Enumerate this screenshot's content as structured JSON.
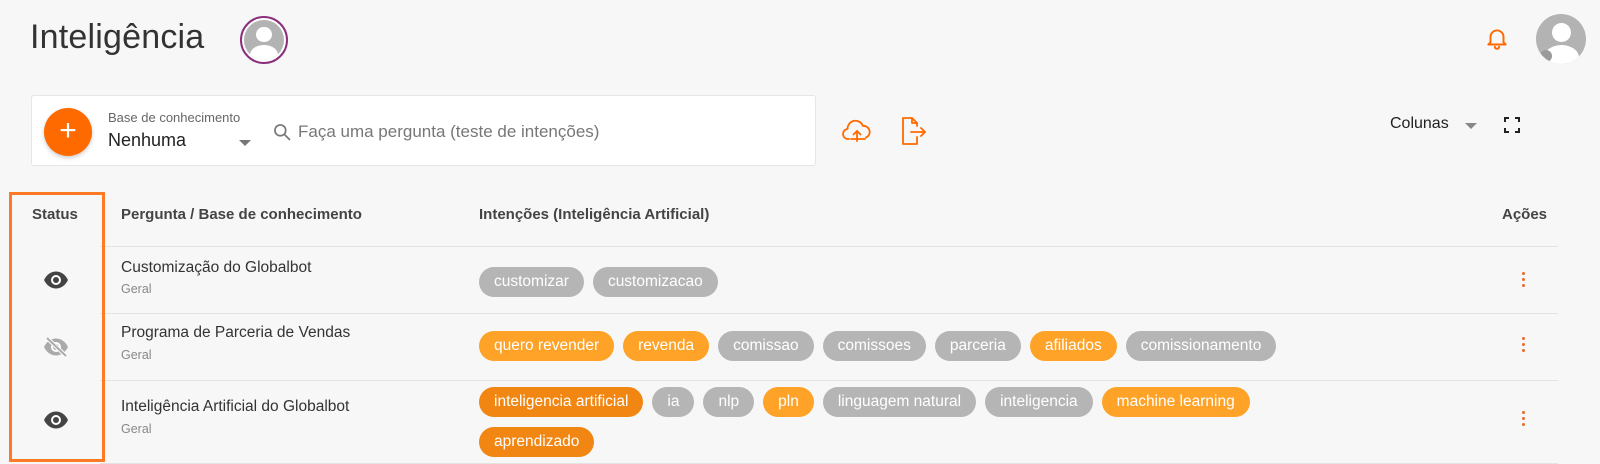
{
  "header": {
    "title": "Inteligência"
  },
  "search": {
    "kb_label": "Base de conhecimento",
    "kb_value": "Nenhuma",
    "placeholder": "Faça uma pergunta (teste de intenções)",
    "add_label": "+"
  },
  "toolbar": {
    "columns_label": "Colunas"
  },
  "table": {
    "headers": {
      "status": "Status",
      "question": "Pergunta / Base de conhecimento",
      "intents": "Intenções (Inteligência Artificial)",
      "actions": "Ações"
    },
    "rows": [
      {
        "status": "visible",
        "title": "Customização do Globalbot",
        "kb": "Geral",
        "intents": [
          {
            "label": "customizar",
            "style": "gray"
          },
          {
            "label": "customizacao",
            "style": "gray"
          }
        ]
      },
      {
        "status": "hidden",
        "title": "Programa de Parceria de Vendas",
        "kb": "Geral",
        "intents": [
          {
            "label": "quero revender",
            "style": "orange"
          },
          {
            "label": "revenda",
            "style": "orange"
          },
          {
            "label": "comissao",
            "style": "gray"
          },
          {
            "label": "comissoes",
            "style": "gray"
          },
          {
            "label": "parceria",
            "style": "gray"
          },
          {
            "label": "afiliados",
            "style": "orange"
          },
          {
            "label": "comissionamento",
            "style": "gray"
          }
        ]
      },
      {
        "status": "visible",
        "title": "Inteligência Artificial do Globalbot",
        "kb": "Geral",
        "intents": [
          {
            "label": "inteligencia artificial",
            "style": "dark"
          },
          {
            "label": "ia",
            "style": "gray"
          },
          {
            "label": "nlp",
            "style": "gray"
          },
          {
            "label": "pln",
            "style": "orange"
          },
          {
            "label": "linguagem natural",
            "style": "gray"
          },
          {
            "label": "inteligencia",
            "style": "gray"
          },
          {
            "label": "machine learning",
            "style": "orange"
          },
          {
            "label": "aprendizado",
            "style": "dark"
          }
        ]
      }
    ]
  },
  "icons": {
    "bell": "bell-icon",
    "upload": "cloud-upload-icon",
    "export": "file-export-icon",
    "fullscreen": "fullscreen-icon",
    "search": "search-icon",
    "actions": "more-vertical-icon",
    "status_visible": "eye-icon",
    "status_hidden": "eye-off-icon"
  },
  "colors": {
    "accent": "#ff6a00",
    "chip_gray": "#b5b5b5",
    "chip_orange": "#ffa228",
    "chip_dark_orange": "#f28612",
    "highlight_border": "#ff7a25"
  }
}
